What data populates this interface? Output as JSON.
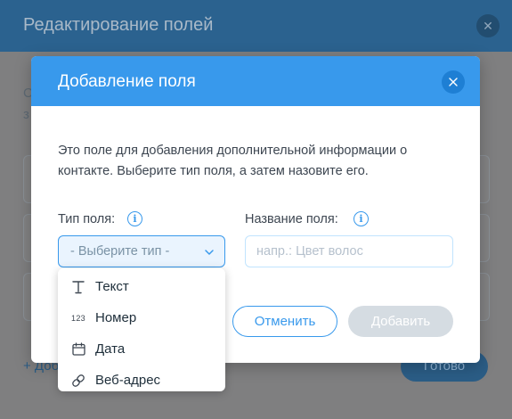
{
  "background": {
    "title": "Редактирование полей",
    "add_link": "+ Доб",
    "done_button": "Готово"
  },
  "modal": {
    "title": "Добавление поля",
    "description": "Это поле для добавления дополнительной информации о контакте. Выберите тип поля, а затем назовите его.",
    "type_label": "Тип поля:",
    "name_label": "Название поля:",
    "select_placeholder": "- Выберите тип -",
    "name_placeholder": "напр.: Цвет волос",
    "cancel_label": "Отменить",
    "add_label": "Добавить"
  },
  "dropdown": {
    "items": [
      {
        "label": "Текст",
        "icon": "text-icon"
      },
      {
        "label": "Номер",
        "icon": "number-icon",
        "icon_text": "123"
      },
      {
        "label": "Дата",
        "icon": "calendar-icon"
      },
      {
        "label": "Веб-адрес",
        "icon": "link-icon"
      }
    ]
  },
  "colors": {
    "accent": "#3899ec",
    "dimmed_header": "#2b628f",
    "overlay": "#7f7f80",
    "disabled_button": "#d5dce2"
  }
}
